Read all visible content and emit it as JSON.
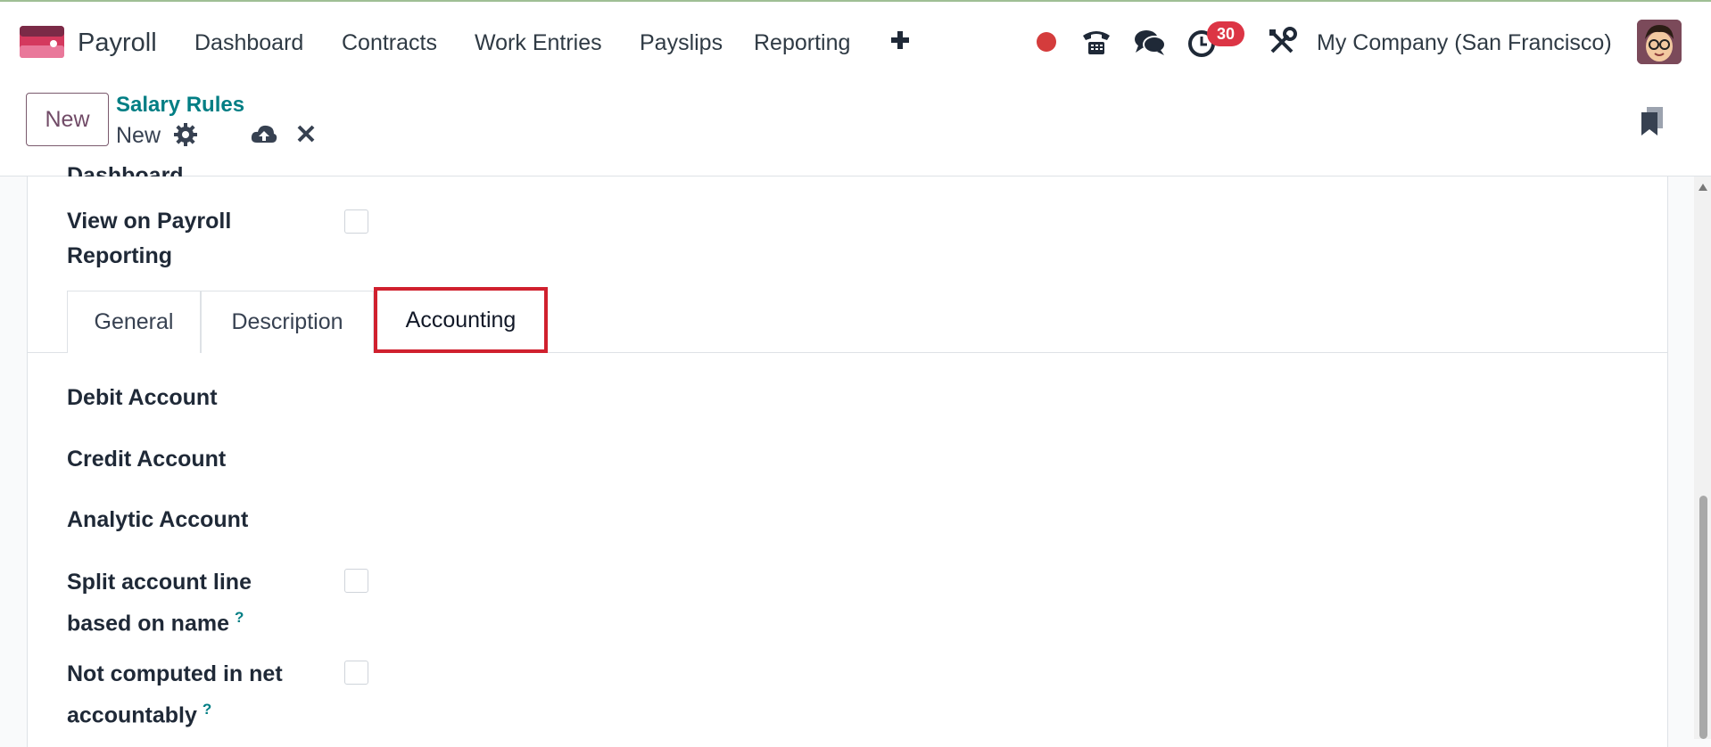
{
  "navbar": {
    "app_name": "Payroll",
    "menu": [
      "Dashboard",
      "Contracts",
      "Work Entries",
      "Payslips",
      "Reporting"
    ],
    "activity_count": "30",
    "company": "My Company (San Francisco)",
    "icons": [
      "payroll-app-icon",
      "plus-icon",
      "record-dot-icon",
      "phone-icon",
      "chat-icon",
      "clock-icon",
      "tools-icon",
      "user-avatar"
    ]
  },
  "control_panel": {
    "new_button": "New",
    "breadcrumb": "Salary Rules",
    "record_name": "New",
    "icons": [
      "gear-icon",
      "cloud-upload-icon",
      "close-icon",
      "bookmark-icon"
    ]
  },
  "form": {
    "cut_label": "Dashboard",
    "view_on_reporting": "View on Payroll Reporting",
    "tabs": [
      "General",
      "Description",
      "Accounting"
    ],
    "active_tab": "Accounting",
    "fields": {
      "debit_account": "Debit Account",
      "credit_account": "Credit Account",
      "analytic_account": "Analytic Account",
      "split_line": "Split account line based on name",
      "not_computed": "Not computed in net accountably",
      "help_mark": "?"
    }
  },
  "colors": {
    "brand": "#714b67",
    "link": "#017e84",
    "badge": "#dc3545",
    "highlight": "#d0202e"
  }
}
